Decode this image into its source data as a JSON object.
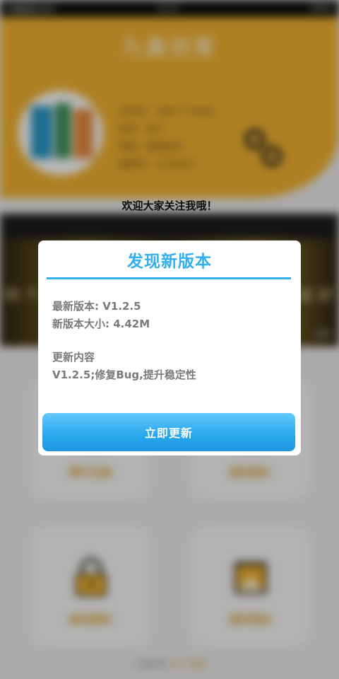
{
  "status_bar": {
    "left": "中国联通 WiFi",
    "time": "14:27",
    "right": "100%"
  },
  "app": {
    "title": "九鑫创客"
  },
  "profile": {
    "lines": [
      "手机号：188****0000",
      "姓名：张三",
      "等级：普通会员",
      "推荐码：1234567"
    ]
  },
  "welcome_text": "欢迎大家关注我哦！",
  "banner": {
    "left_text": "你\n个",
    "right_text": "迷\n好",
    "page_indicator": "2/3"
  },
  "menu": {
    "items": [
      {
        "label": "帮忙注册",
        "icon": "clipboard-icon"
      },
      {
        "label": "我的团队",
        "icon": "clipboard-icon"
      },
      {
        "label": "修改密码",
        "icon": "lock-icon"
      },
      {
        "label": "我的钱包",
        "icon": "wallet-icon"
      }
    ]
  },
  "footer": {
    "text": "九鑫创客",
    "link1": "关于",
    "link2": "帮助"
  },
  "dialog": {
    "title": "发现新版本",
    "latest_version": "最新版本: V1.2.5",
    "package_size": "新版本大小: 4.42M",
    "changelog_heading": "更新内容",
    "changelog_text": "V1.2.5;修复Bug,提升稳定性",
    "update_button": "立即更新"
  },
  "colors": {
    "accent_blue": "#33aff0",
    "header_orange": "#f2b230",
    "menu_label": "#d4951a"
  }
}
